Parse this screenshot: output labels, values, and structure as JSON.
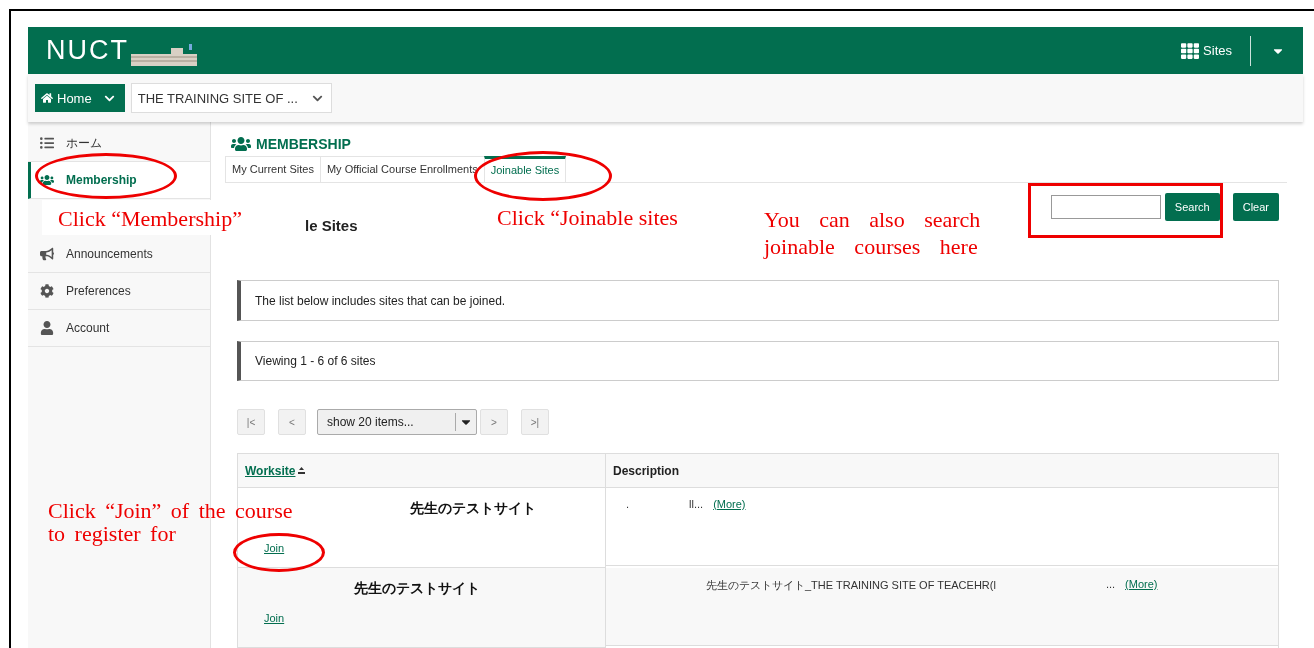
{
  "header": {
    "logo": "NUCT",
    "sites": "Sites"
  },
  "nav": {
    "home": "Home",
    "site_select": "THE TRAINING SITE OF ..."
  },
  "sidebar": {
    "items": [
      {
        "label": "ホーム",
        "selected": false
      },
      {
        "label": "Membership",
        "selected": true
      },
      {
        "label": "Announcements",
        "selected": false
      },
      {
        "label": "Preferences",
        "selected": false
      },
      {
        "label": "Account",
        "selected": false
      }
    ]
  },
  "tool": {
    "title": "MEMBERSHIP",
    "tabs": [
      {
        "label": "My Current Sites",
        "selected": false
      },
      {
        "label": "My Official Course Enrollments",
        "selected": false
      },
      {
        "label": "Joinable Sites",
        "selected": true
      }
    ],
    "heading": "le Sites",
    "search": {
      "button": "Search",
      "clear": "Clear"
    },
    "messages": [
      "The list below includes sites that can be joined.",
      "Viewing 1 - 6 of 6 sites"
    ],
    "pager": {
      "first": "|<",
      "prev": "<",
      "page_size": "show 20 items...",
      "next": ">",
      "last": ">|"
    },
    "table": {
      "columns": [
        {
          "label": "Worksite",
          "sortable": true
        },
        {
          "label": "Description",
          "sortable": false
        }
      ],
      "rows": [
        {
          "worksite": "先生のテストサイト",
          "action": "Join",
          "description": [
            ".",
            "ll..."
          ],
          "more": "(More)"
        },
        {
          "worksite": "先生のテストサイト",
          "action": "Join",
          "description": [
            "先生のテストサイト_THE TRAINING SITE OF TEACEHR(l",
            "..."
          ],
          "more": "(More)"
        }
      ]
    }
  },
  "annotations": [
    {
      "lines": [
        "Click “Membership”"
      ]
    },
    {
      "lines": [
        "Click “Joinable sites"
      ]
    },
    {
      "lines": [
        "You can also search",
        "joinable courses here"
      ]
    },
    {
      "lines": [
        "Click “Join” of the course",
        "to register for"
      ]
    }
  ]
}
